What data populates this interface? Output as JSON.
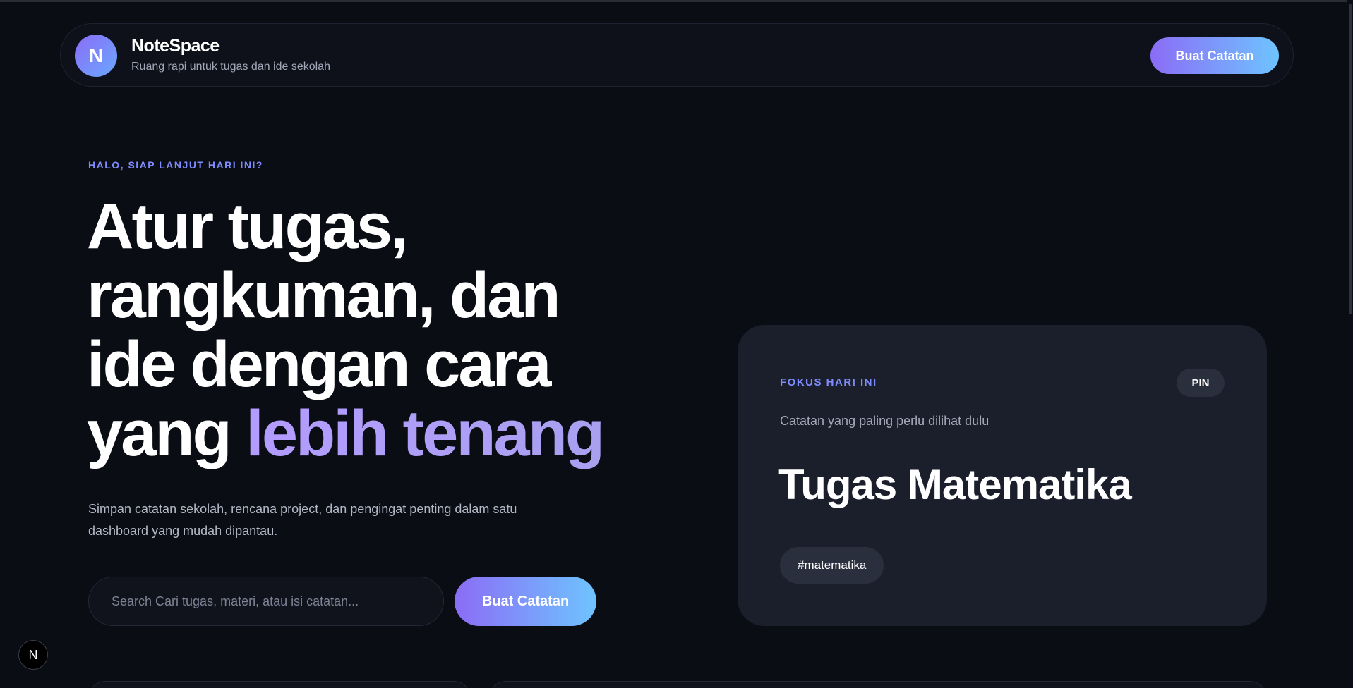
{
  "header": {
    "logo_letter": "N",
    "brand_name": "NoteSpace",
    "tagline": "Ruang rapi untuk tugas dan ide sekolah",
    "cta_label": "Buat Catatan"
  },
  "hero": {
    "eyebrow": "HALO, SIAP LANJUT HARI INI?",
    "title_line1": "Atur tugas,",
    "title_line2": "rangkuman, dan",
    "title_line3": "ide dengan cara",
    "title_line4_plain": "yang ",
    "title_line4_accent": "lebih tenang",
    "description": "Simpan catatan sekolah, rencana project, dan pengingat penting dalam satu dashboard yang mudah dipantau.",
    "search_placeholder": "Search Cari tugas, materi, atau isi catatan...",
    "search_value": "",
    "cta_label": "Buat Catatan"
  },
  "focus_card": {
    "eyebrow": "FOKUS HARI INI",
    "badge": "PIN",
    "subtitle": "Catatan yang paling perlu dilihat dulu",
    "title": "Tugas Matematika",
    "tag": "#matematika"
  },
  "dev_badge": {
    "letter": "N"
  },
  "colors": {
    "background": "#0b0d14",
    "accent_blue": "#7f8cff",
    "accent_purple": "#b39cff",
    "gradient_start": "#8b6cf6",
    "gradient_end": "#6ec4ff",
    "card_bg": "#1b1f2b"
  }
}
